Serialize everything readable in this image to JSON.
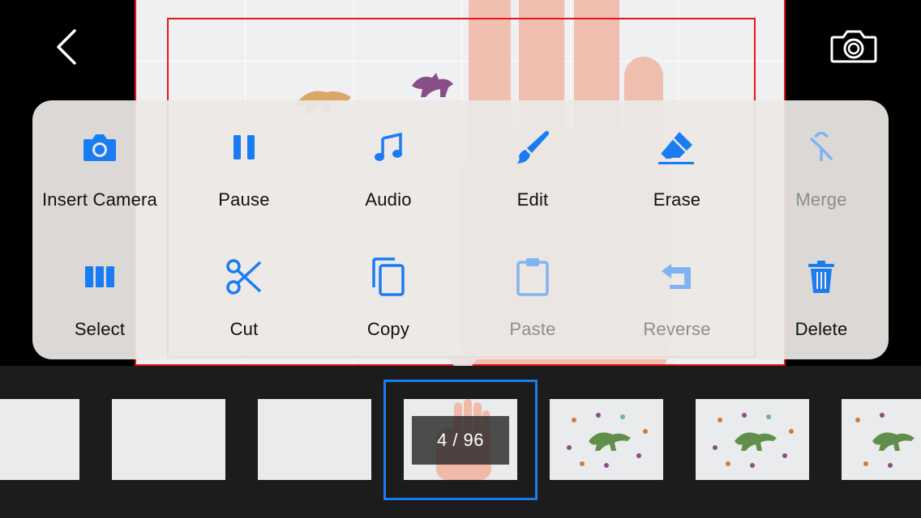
{
  "toolbar": {
    "back_icon": "chevron-left-icon",
    "camera_icon": "camera-icon"
  },
  "menu": {
    "row1": [
      {
        "label": "Insert Camera",
        "icon": "camera-icon",
        "enabled": true
      },
      {
        "label": "Pause",
        "icon": "pause-icon",
        "enabled": true
      },
      {
        "label": "Audio",
        "icon": "music-note-icon",
        "enabled": true
      },
      {
        "label": "Edit",
        "icon": "paintbrush-icon",
        "enabled": true
      },
      {
        "label": "Erase",
        "icon": "eraser-icon",
        "enabled": true
      },
      {
        "label": "Merge",
        "icon": "merge-icon",
        "enabled": false
      }
    ],
    "row2": [
      {
        "label": "Select",
        "icon": "columns-icon",
        "enabled": true
      },
      {
        "label": "Cut",
        "icon": "scissors-icon",
        "enabled": true
      },
      {
        "label": "Copy",
        "icon": "copy-icon",
        "enabled": true
      },
      {
        "label": "Paste",
        "icon": "clipboard-icon",
        "enabled": false
      },
      {
        "label": "Reverse",
        "icon": "reverse-icon",
        "enabled": false
      },
      {
        "label": "Delete",
        "icon": "trash-icon",
        "enabled": true
      }
    ]
  },
  "timeline": {
    "frame_counter": "4 / 96",
    "current_frame": 4,
    "total_frames": 96
  },
  "colors": {
    "accent": "#1a7cf2",
    "accent_disabled": "#7fb4f3",
    "frame_border": "#e8141a",
    "strip_bg": "#1c1c1c"
  }
}
